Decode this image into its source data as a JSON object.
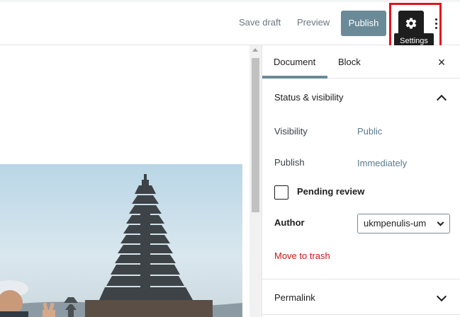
{
  "header": {
    "save_draft_label": "Save draft",
    "preview_label": "Preview",
    "publish_label": "Publish",
    "settings_tooltip": "Settings",
    "settings_icon": "gear-icon",
    "more_icon": "vertical-ellipsis-icon"
  },
  "sidebar": {
    "tabs": [
      {
        "label": "Document",
        "active": true
      },
      {
        "label": "Block",
        "active": false
      }
    ],
    "close_icon": "close-icon",
    "close_glyph": "×",
    "status_panel": {
      "title": "Status & visibility",
      "visibility_label": "Visibility",
      "visibility_value": "Public",
      "publish_label": "Publish",
      "publish_value": "Immediately",
      "pending_review_label": "Pending review",
      "pending_review_checked": false,
      "author_label": "Author",
      "author_value": "ukmpenulis-um",
      "move_to_trash_label": "Move to trash"
    },
    "permalink_panel": {
      "title": "Permalink"
    }
  },
  "colors": {
    "accent": "#6b8a98",
    "highlight": "#e0141e",
    "trash": "#cc1818",
    "link": "#5b7a8a"
  }
}
